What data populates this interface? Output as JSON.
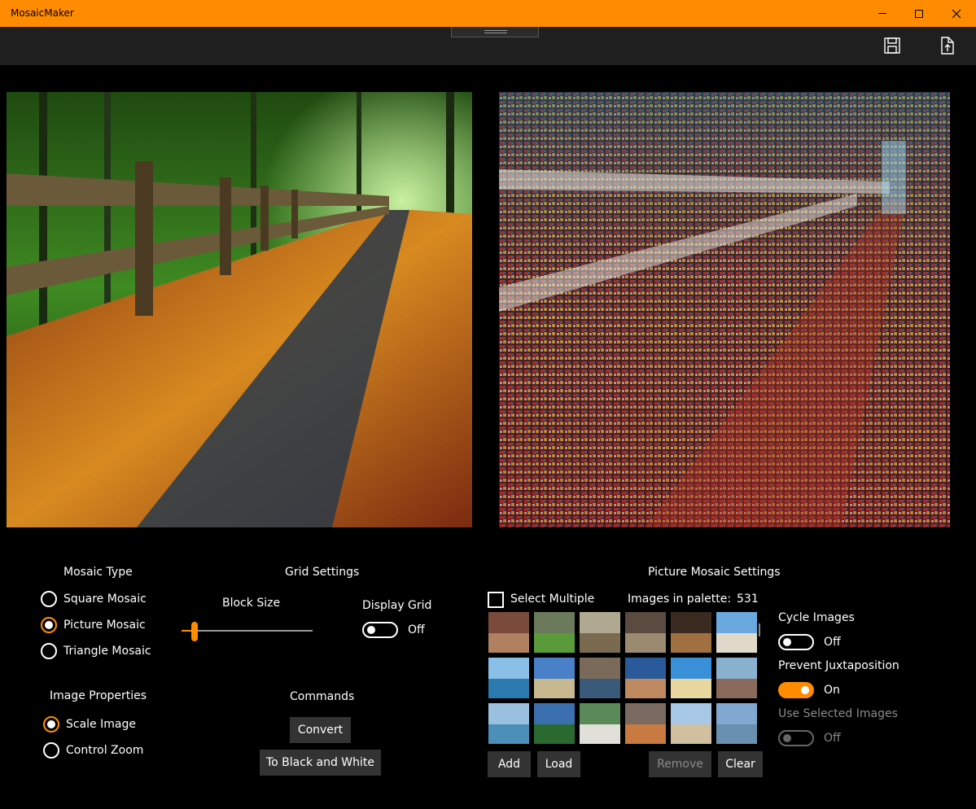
{
  "window": {
    "title": "MosaicMaker"
  },
  "mosaic_type": {
    "heading": "Mosaic Type",
    "options": [
      "Square Mosaic",
      "Picture Mosaic",
      "Triangle Mosaic"
    ],
    "selected": "Picture Mosaic"
  },
  "image_properties": {
    "heading": "Image Properties",
    "options": [
      "Scale Image",
      "Control Zoom"
    ],
    "selected": "Scale Image"
  },
  "grid_settings": {
    "heading": "Grid Settings",
    "block_size_label": "Block Size",
    "block_size_level": 0.1,
    "display_grid_label": "Display Grid",
    "display_grid_state": "Off"
  },
  "commands": {
    "heading": "Commands",
    "convert": "Convert",
    "to_bw": "To Black and White"
  },
  "picture_mosaic": {
    "heading": "Picture Mosaic Settings",
    "select_multiple": "Select Multiple",
    "images_in_palette_label": "Images in palette:",
    "images_in_palette_count": "531",
    "buttons": {
      "add": "Add",
      "load": "Load",
      "remove": "Remove",
      "clear": "Clear"
    },
    "cycle_images_label": "Cycle Images",
    "cycle_images_state": "Off",
    "prevent_juxtaposition_label": "Prevent Juxtaposition",
    "prevent_juxtaposition_state": "On",
    "use_selected_label": "Use Selected Images",
    "use_selected_state": "Off"
  },
  "palette_thumbnails": [
    {
      "sky": "#7a4a3a",
      "ground": "#b08060"
    },
    {
      "sky": "#6a7a5a",
      "ground": "#5a9a3a"
    },
    {
      "sky": "#b0a890",
      "ground": "#7a6a50"
    },
    {
      "sky": "#5a4a40",
      "ground": "#9a8a70"
    },
    {
      "sky": "#3a2a20",
      "ground": "#a07040"
    },
    {
      "sky": "#6aa8e0",
      "ground": "#e0d8c8"
    },
    {
      "sky": "#8ac0e8",
      "ground": "#2a7ab0"
    },
    {
      "sky": "#4a80c8",
      "ground": "#c8b890"
    },
    {
      "sky": "#7a6a5a",
      "ground": "#3a5a7a"
    },
    {
      "sky": "#2a5a9a",
      "ground": "#c08a60"
    },
    {
      "sky": "#3a90d8",
      "ground": "#e8d8a0"
    },
    {
      "sky": "#8ab0d0",
      "ground": "#8a6a5a"
    },
    {
      "sky": "#9ac0e0",
      "ground": "#4a90b8"
    },
    {
      "sky": "#3a70b0",
      "ground": "#2a6a30"
    },
    {
      "sky": "#5a8a5a",
      "ground": "#e0e0d8"
    },
    {
      "sky": "#7a6a60",
      "ground": "#c87a40"
    },
    {
      "sky": "#a8c8e8",
      "ground": "#d0c0a0"
    },
    {
      "sky": "#80a8d0",
      "ground": "#6a90b0"
    }
  ],
  "colors": {
    "accent": "#ff8c00",
    "button": "#333333",
    "commandbar": "#1f1f1f"
  },
  "icons": {
    "save": "save-icon",
    "share": "share-icon"
  }
}
